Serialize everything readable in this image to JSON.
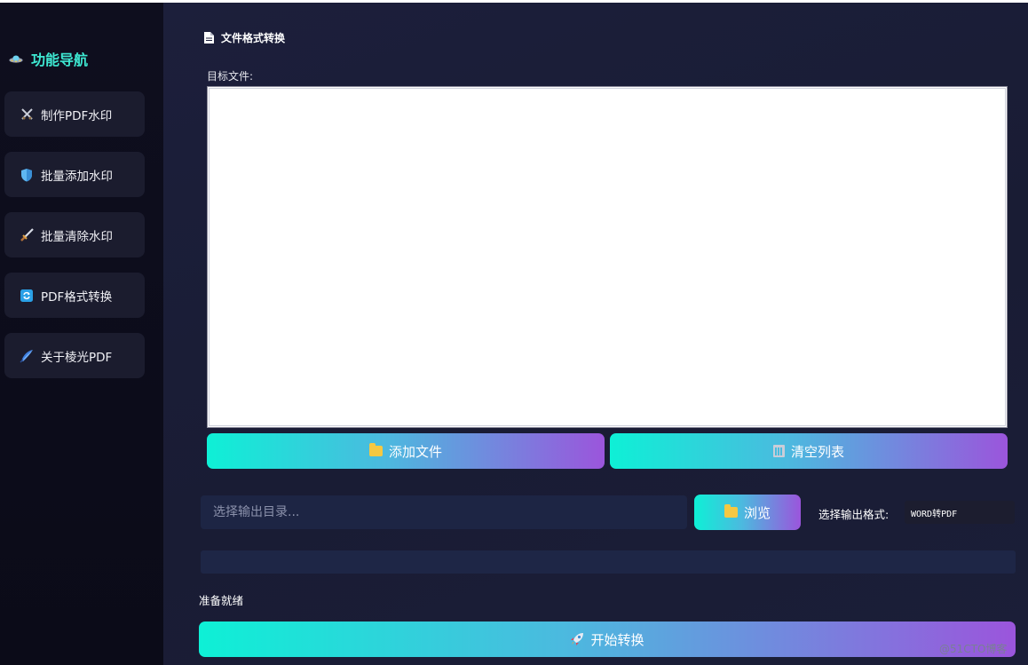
{
  "sidebar": {
    "title": "功能导航",
    "title_icon": "ufo-icon",
    "items": [
      {
        "label": "制作PDF水印",
        "icon": "crossed-swords-icon"
      },
      {
        "label": "批量添加水印",
        "icon": "shield-icon"
      },
      {
        "label": "批量清除水印",
        "icon": "dagger-icon"
      },
      {
        "label": "PDF格式转换",
        "icon": "refresh-icon"
      },
      {
        "label": "关于棱光PDF",
        "icon": "feather-pen-icon"
      }
    ]
  },
  "main": {
    "section_title": "文件格式转换",
    "section_icon": "document-icon",
    "target_label": "目标文件:",
    "add_file_label": "添加文件",
    "clear_list_label": "清空列表",
    "output_dir_placeholder": "选择输出目录...",
    "browse_label": "浏览",
    "format_label": "选择输出格式:",
    "format_value": "WORD转PDF",
    "progress_percent": 0,
    "status": "准备就绪",
    "start_label": "开始转换"
  },
  "watermark": "@51CTO博客",
  "colors": {
    "accent": "#3ee8d2",
    "gradient_start": "#0ef0d6",
    "gradient_end": "#9b55dc",
    "sidebar_bg": "#0d0d1c",
    "main_bg": "#1b1e38"
  }
}
